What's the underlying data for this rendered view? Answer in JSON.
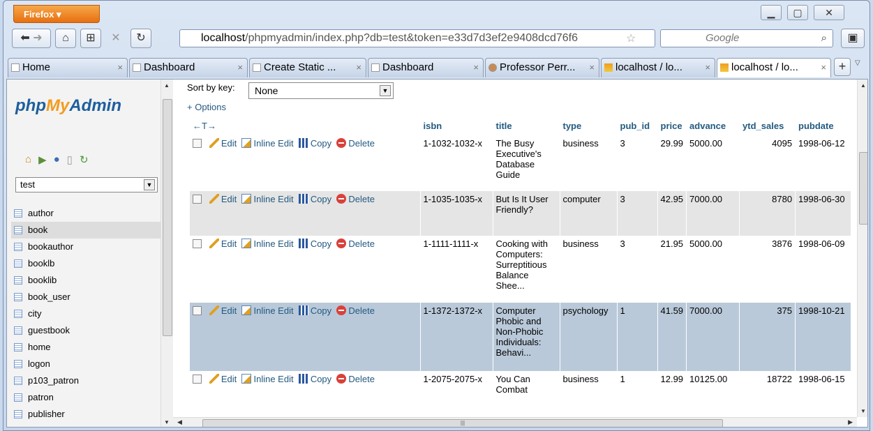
{
  "browser": {
    "menu_label": "Firefox ▾",
    "url_host": "localhost",
    "url_path": "/phpmyadmin/index.php?db=test&token=e33d7d3ef2e9408dcd76f6",
    "search_placeholder": "Google",
    "tabs": [
      {
        "label": "Home"
      },
      {
        "label": "Dashboard"
      },
      {
        "label": "Create Static ..."
      },
      {
        "label": "Dashboard"
      },
      {
        "label": "Professor Perr..."
      },
      {
        "label": "localhost / lo..."
      },
      {
        "label": "localhost / lo..."
      }
    ]
  },
  "sidebar": {
    "logo_php": "php",
    "logo_my": "My",
    "logo_admin": "Admin",
    "db_selected": "test",
    "tables": [
      "author",
      "book",
      "bookauthor",
      "booklb",
      "booklib",
      "book_user",
      "city",
      "guestbook",
      "home",
      "logon",
      "p103_patron",
      "patron",
      "publisher"
    ]
  },
  "main": {
    "sort_label": "Sort by key:",
    "sort_value": "None",
    "options_link": "+ Options",
    "resize_glyph": "←T→",
    "actions": {
      "edit": "Edit",
      "inline_edit": "Inline Edit",
      "copy": "Copy",
      "delete": "Delete"
    },
    "columns": [
      "isbn",
      "title",
      "type",
      "pub_id",
      "price",
      "advance",
      "ytd_sales",
      "pubdate"
    ],
    "rows": [
      {
        "isbn": "1-1032-1032-x",
        "title": "The Busy Executive's Database Guide",
        "type": "business",
        "pub_id": "3",
        "price": "29.99",
        "advance": "5000.00",
        "ytd_sales": "4095",
        "pubdate": "1998-06-12"
      },
      {
        "isbn": "1-1035-1035-x",
        "title": "But Is It User Friendly?",
        "type": "computer",
        "pub_id": "3",
        "price": "42.95",
        "advance": "7000.00",
        "ytd_sales": "8780",
        "pubdate": "1998-06-30"
      },
      {
        "isbn": "1-1111-1111-x",
        "title": "Cooking with Computers: Surreptitious Balance Shee...",
        "type": "business",
        "pub_id": "3",
        "price": "21.95",
        "advance": "5000.00",
        "ytd_sales": "3876",
        "pubdate": "1998-06-09"
      },
      {
        "isbn": "1-1372-1372-x",
        "title": "Computer Phobic and Non-Phobic Individuals: Behavi...",
        "type": "psychology",
        "pub_id": "1",
        "price": "41.59",
        "advance": "7000.00",
        "ytd_sales": "375",
        "pubdate": "1998-10-21"
      },
      {
        "isbn": "1-2075-2075-x",
        "title": "You Can Combat",
        "type": "business",
        "pub_id": "1",
        "price": "12.99",
        "advance": "10125.00",
        "ytd_sales": "18722",
        "pubdate": "1998-06-15"
      }
    ]
  },
  "colors": {
    "link": "#235a81",
    "marked_row": "#b9c9d9",
    "logo_blue": "#1e5e9e",
    "logo_orange": "#f29c1f"
  }
}
